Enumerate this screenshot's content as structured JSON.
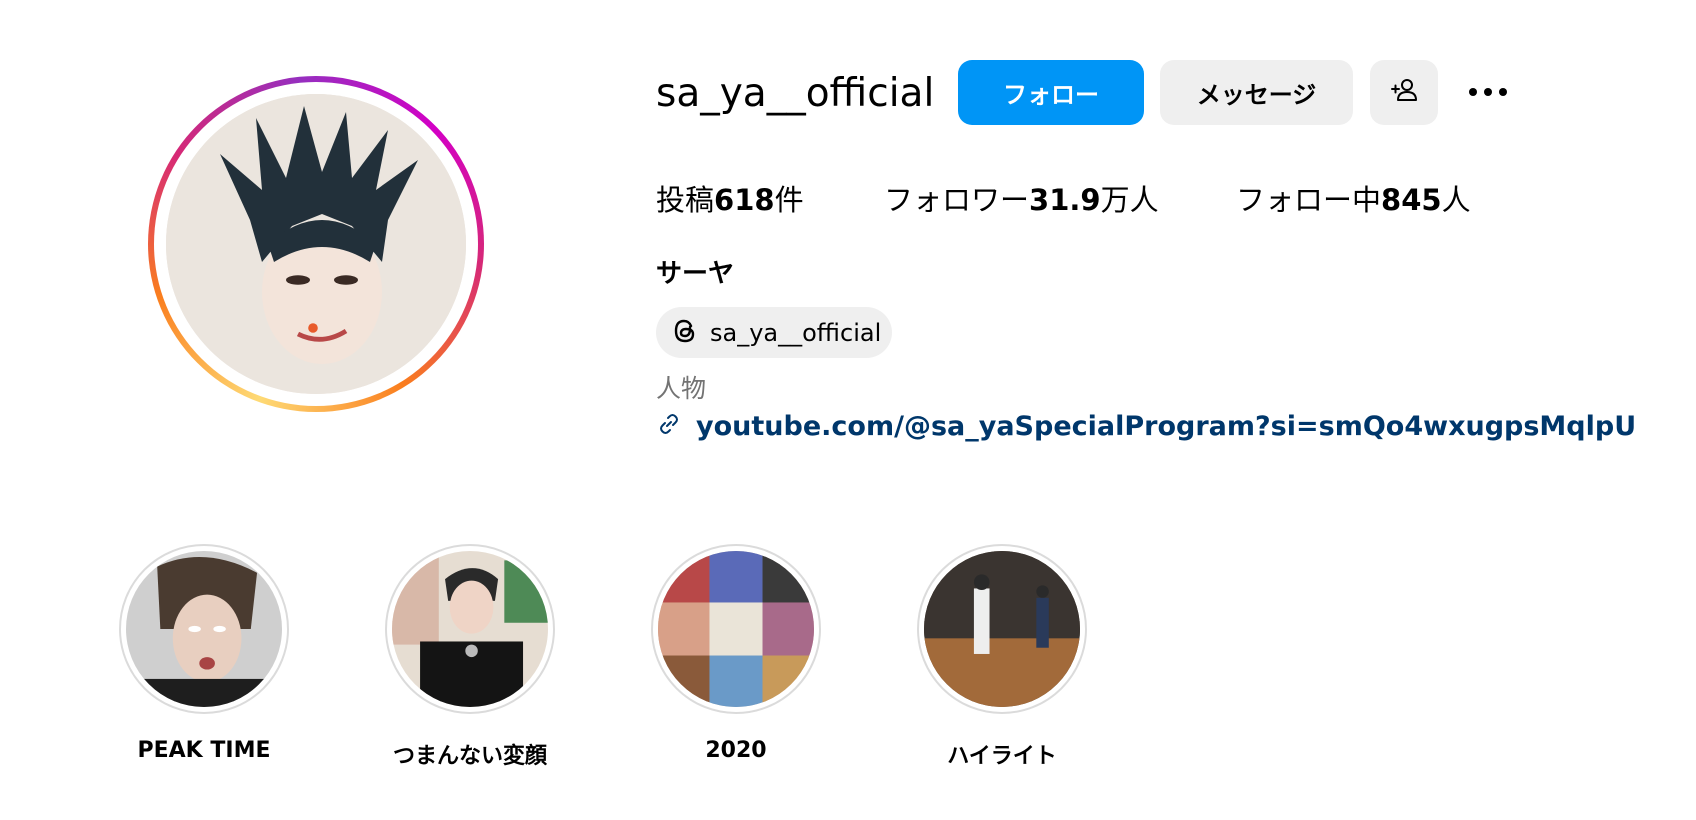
{
  "profile": {
    "username": "sa_ya__official",
    "full_name": "サーヤ",
    "category": "人物",
    "threads_handle": "sa_ya__official",
    "link": "youtube.com/@sa_yaSpecialProgram?si=smQo4wxugpsMqlpU"
  },
  "actions": {
    "follow_label": "フォロー",
    "message_label": "メッセージ",
    "add_user_icon": "person-plus-icon",
    "more_icon": "ellipsis-icon"
  },
  "stats": {
    "posts_prefix": "投稿",
    "posts_value": "618",
    "posts_suffix": "件",
    "followers_prefix": "フォロワー",
    "followers_value": "31.9",
    "followers_suffix": "万人",
    "following_prefix": "フォロー中",
    "following_value": "845",
    "following_suffix": "人"
  },
  "highlights": [
    {
      "label": "PEAK TIME"
    },
    {
      "label": "つまんない変顔"
    },
    {
      "label": "2020"
    },
    {
      "label": "ハイライト"
    }
  ],
  "colors": {
    "follow_button": "#0095f6",
    "secondary_button": "#efefef",
    "link": "#00376b",
    "muted_text": "#737373"
  }
}
